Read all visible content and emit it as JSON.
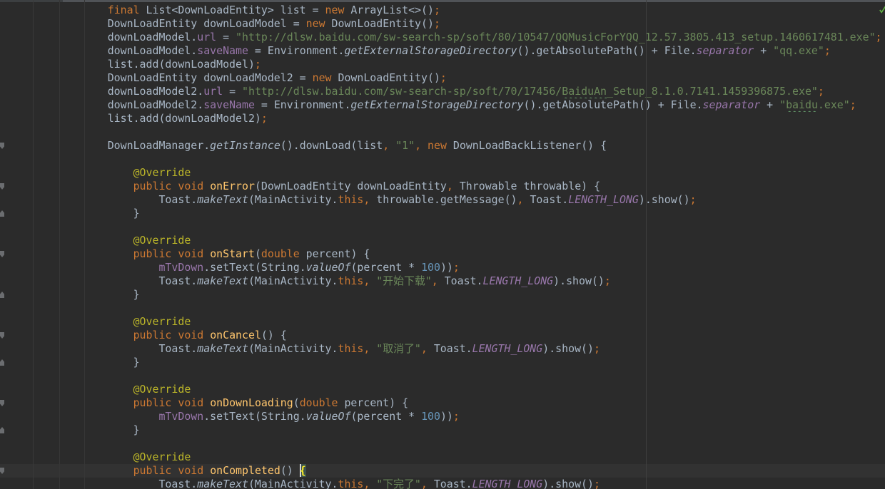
{
  "window": {
    "status_icon": "check-icon"
  },
  "theme": {
    "background": "#2B2B2B",
    "current_line": "#323232",
    "text": "#A9B7C6",
    "keyword": "#CC7832",
    "string": "#6A8759",
    "number": "#6897BB",
    "field": "#9876AA",
    "annotation": "#BBB529",
    "method_declaration": "#FFC66D",
    "brace_match": "#FFEF28",
    "brace_match_background": "#3B514D",
    "typo_underline": "#659C6B",
    "status_ok": "#62B543"
  },
  "editor": {
    "lines": [
      {
        "tokens": [
          {
            "p": "        "
          },
          {
            "k": "final"
          },
          {
            "p": " List<DownLoadEntity> list = "
          },
          {
            "k": "new"
          },
          {
            "p": " ArrayList<>()"
          },
          {
            "k": ";"
          }
        ]
      },
      {
        "tokens": [
          {
            "p": "        DownLoadEntity downLoadModel = "
          },
          {
            "k": "new"
          },
          {
            "p": " DownLoadEntity()"
          },
          {
            "k": ";"
          }
        ]
      },
      {
        "tokens": [
          {
            "p": "        downLoadModel."
          },
          {
            "f": "url"
          },
          {
            "p": " = "
          },
          {
            "s": "\"http://dlsw.baidu.com/sw-search-sp/soft/80/10547/QQMusicForYQQ_12.57.3805.413_setup.1460617481.exe\""
          },
          {
            "k": ";"
          }
        ]
      },
      {
        "tokens": [
          {
            "p": "        downLoadModel."
          },
          {
            "f": "saveName"
          },
          {
            "p": " = Environment."
          },
          {
            "sm": "getExternalStorageDirectory"
          },
          {
            "p": "().getAbsolutePath() + File."
          },
          {
            "sf": "separator"
          },
          {
            "p": " + "
          },
          {
            "s": "\"qq.exe\""
          },
          {
            "k": ";"
          }
        ]
      },
      {
        "tokens": [
          {
            "p": "        list.add(downLoadModel)"
          },
          {
            "k": ";"
          }
        ]
      },
      {
        "tokens": [
          {
            "p": "        DownLoadEntity downLoadModel2 = "
          },
          {
            "k": "new"
          },
          {
            "p": " DownLoadEntity()"
          },
          {
            "k": ";"
          }
        ]
      },
      {
        "tokens": [
          {
            "p": "        downLoadModel2."
          },
          {
            "f": "url"
          },
          {
            "p": " = "
          },
          {
            "s": "\"http://dlsw.baidu.com/sw-search-sp/soft/70/17456/"
          },
          {
            "sw": "BaiduAn"
          },
          {
            "s": "_Setup_8.1.0.7141.1459396875.exe\""
          },
          {
            "k": ";"
          }
        ]
      },
      {
        "tokens": [
          {
            "p": "        downLoadModel2."
          },
          {
            "f": "saveName"
          },
          {
            "p": " = Environment."
          },
          {
            "sm": "getExternalStorageDirectory"
          },
          {
            "p": "().getAbsolutePath() + File."
          },
          {
            "sf": "separator"
          },
          {
            "p": " + "
          },
          {
            "s": "\""
          },
          {
            "sw": "baidu"
          },
          {
            "s": ".exe\""
          },
          {
            "k": ";"
          }
        ]
      },
      {
        "tokens": [
          {
            "p": "        list.add(downLoadModel2)"
          },
          {
            "k": ";"
          }
        ]
      },
      {
        "tokens": []
      },
      {
        "fold": "fold-start-icon",
        "tokens": [
          {
            "p": "        DownLoadManager."
          },
          {
            "sm": "getInstance"
          },
          {
            "p": "().downLoad(list"
          },
          {
            "k": ","
          },
          {
            "p": " "
          },
          {
            "s": "\"1\""
          },
          {
            "k": ","
          },
          {
            "p": " "
          },
          {
            "k": "new"
          },
          {
            "p": " DownLoadBackListener() {"
          }
        ]
      },
      {
        "tokens": []
      },
      {
        "tokens": [
          {
            "p": "            "
          },
          {
            "a": "@Override"
          }
        ]
      },
      {
        "fold": "fold-start-icon",
        "tokens": [
          {
            "p": "            "
          },
          {
            "k": "public void"
          },
          {
            "p": " "
          },
          {
            "m": "onError"
          },
          {
            "p": "(DownLoadEntity downLoadEntity"
          },
          {
            "k": ","
          },
          {
            "p": " Throwable throwable) {"
          }
        ]
      },
      {
        "tokens": [
          {
            "p": "                Toast."
          },
          {
            "sm": "makeText"
          },
          {
            "p": "(MainActivity."
          },
          {
            "k": "this,"
          },
          {
            "p": " throwable.getMessage()"
          },
          {
            "k": ","
          },
          {
            "p": " Toast."
          },
          {
            "sf": "LENGTH_LONG"
          },
          {
            "p": ").show()"
          },
          {
            "k": ";"
          }
        ]
      },
      {
        "fold": "fold-end-icon",
        "tokens": [
          {
            "p": "            }"
          }
        ]
      },
      {
        "tokens": []
      },
      {
        "tokens": [
          {
            "p": "            "
          },
          {
            "a": "@Override"
          }
        ]
      },
      {
        "fold": "fold-start-icon",
        "tokens": [
          {
            "p": "            "
          },
          {
            "k": "public void"
          },
          {
            "p": " "
          },
          {
            "m": "onStart"
          },
          {
            "p": "("
          },
          {
            "k": "double"
          },
          {
            "p": " percent) {"
          }
        ]
      },
      {
        "tokens": [
          {
            "p": "                "
          },
          {
            "f": "mTvDown"
          },
          {
            "p": ".setText(String."
          },
          {
            "sm": "valueOf"
          },
          {
            "p": "(percent * "
          },
          {
            "n": "100"
          },
          {
            "p": "))"
          },
          {
            "k": ";"
          }
        ]
      },
      {
        "tokens": [
          {
            "p": "                Toast."
          },
          {
            "sm": "makeText"
          },
          {
            "p": "(MainActivity."
          },
          {
            "k": "this,"
          },
          {
            "p": " "
          },
          {
            "s": "\"开始下载\""
          },
          {
            "k": ","
          },
          {
            "p": " Toast."
          },
          {
            "sf": "LENGTH_LONG"
          },
          {
            "p": ").show()"
          },
          {
            "k": ";"
          }
        ]
      },
      {
        "fold": "fold-end-icon",
        "tokens": [
          {
            "p": "            }"
          }
        ]
      },
      {
        "tokens": []
      },
      {
        "tokens": [
          {
            "p": "            "
          },
          {
            "a": "@Override"
          }
        ]
      },
      {
        "fold": "fold-start-icon",
        "tokens": [
          {
            "p": "            "
          },
          {
            "k": "public void"
          },
          {
            "p": " "
          },
          {
            "m": "onCancel"
          },
          {
            "p": "() {"
          }
        ]
      },
      {
        "tokens": [
          {
            "p": "                Toast."
          },
          {
            "sm": "makeText"
          },
          {
            "p": "(MainActivity."
          },
          {
            "k": "this,"
          },
          {
            "p": " "
          },
          {
            "s": "\"取消了\""
          },
          {
            "k": ","
          },
          {
            "p": " Toast."
          },
          {
            "sf": "LENGTH_LONG"
          },
          {
            "p": ").show()"
          },
          {
            "k": ";"
          }
        ]
      },
      {
        "fold": "fold-end-icon",
        "tokens": [
          {
            "p": "            }"
          }
        ]
      },
      {
        "tokens": []
      },
      {
        "tokens": [
          {
            "p": "            "
          },
          {
            "a": "@Override"
          }
        ]
      },
      {
        "fold": "fold-start-icon",
        "tokens": [
          {
            "p": "            "
          },
          {
            "k": "public void"
          },
          {
            "p": " "
          },
          {
            "m": "onDownLoading"
          },
          {
            "p": "("
          },
          {
            "k": "double"
          },
          {
            "p": " percent) {"
          }
        ]
      },
      {
        "tokens": [
          {
            "p": "                "
          },
          {
            "f": "mTvDown"
          },
          {
            "p": ".setText(String."
          },
          {
            "sm": "valueOf"
          },
          {
            "p": "(percent * "
          },
          {
            "n": "100"
          },
          {
            "p": "))"
          },
          {
            "k": ";"
          }
        ]
      },
      {
        "fold": "fold-end-icon",
        "tokens": [
          {
            "p": "            }"
          }
        ]
      },
      {
        "tokens": []
      },
      {
        "tokens": [
          {
            "p": "            "
          },
          {
            "a": "@Override"
          }
        ]
      },
      {
        "fold": "fold-start-icon",
        "current": true,
        "tokens": [
          {
            "p": "            "
          },
          {
            "k": "public void"
          },
          {
            "p": " "
          },
          {
            "m": "onCompleted"
          },
          {
            "p": "() "
          },
          {
            "bm": "{"
          }
        ]
      },
      {
        "tokens": [
          {
            "p": "                Toast."
          },
          {
            "sm": "makeText"
          },
          {
            "p": "(MainActivity."
          },
          {
            "k": "this,"
          },
          {
            "p": " "
          },
          {
            "s": "\"下完了\""
          },
          {
            "k": ","
          },
          {
            "p": " Toast."
          },
          {
            "sf": "LENGTH_LONG"
          },
          {
            "p": ").show()"
          },
          {
            "k": ";"
          }
        ]
      }
    ]
  }
}
